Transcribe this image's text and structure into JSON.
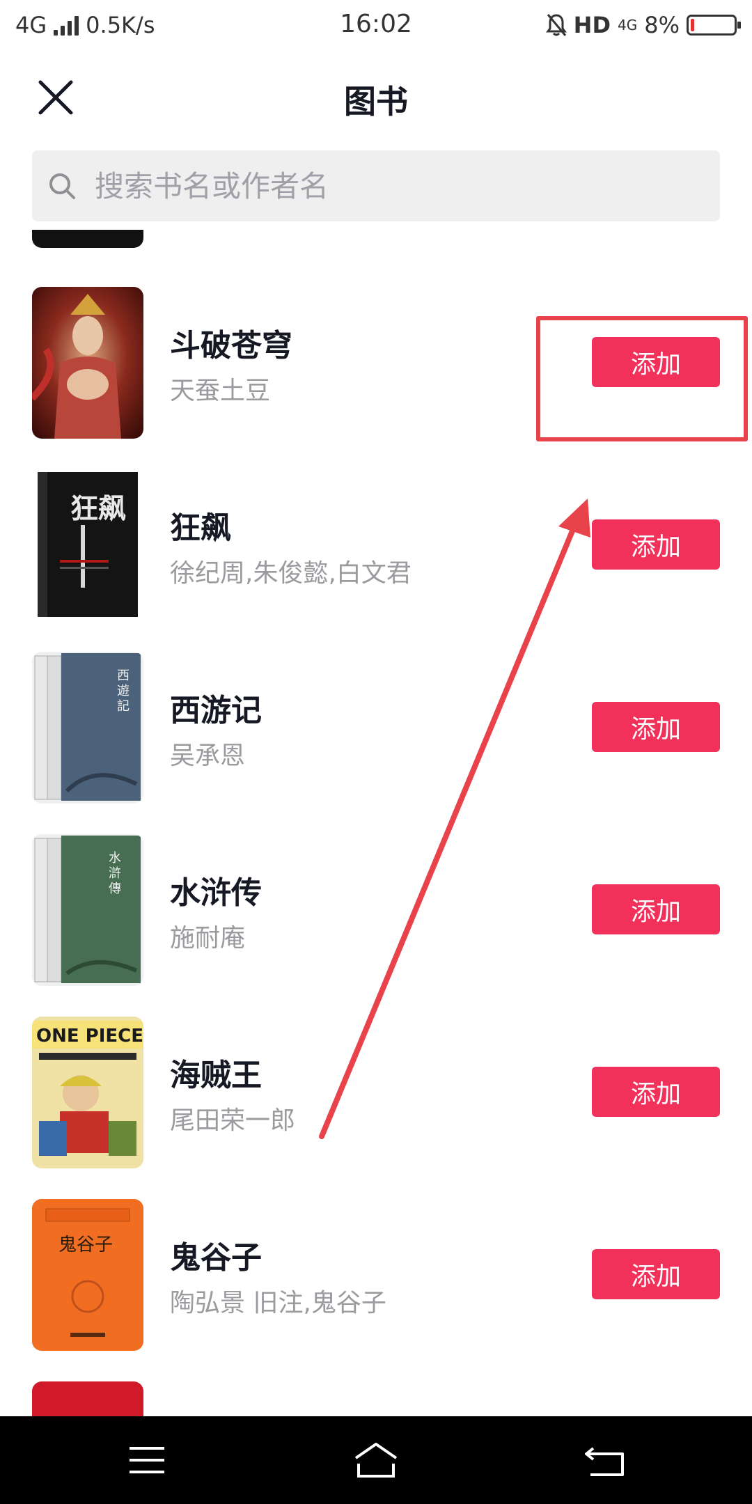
{
  "status_bar": {
    "network": "4G",
    "speed": "0.5K/s",
    "time": "16:02",
    "hd": "HD",
    "network2": "4G",
    "battery": "8%",
    "battery_level": 0.08
  },
  "header": {
    "title": "图书"
  },
  "search": {
    "placeholder": "搜索书名或作者名"
  },
  "books": [
    {
      "title": "斗破苍穹",
      "author": "天蚕土豆",
      "button": "添加",
      "cover": "fantasy-illustration"
    },
    {
      "title": "狂飙",
      "author": "徐纪周,朱俊懿,白文君",
      "button": "添加",
      "cover": "black-book"
    },
    {
      "title": "西游记",
      "author": "吴承恩",
      "button": "添加",
      "cover": "blue-classic"
    },
    {
      "title": "水浒传",
      "author": "施耐庵",
      "button": "添加",
      "cover": "green-classic"
    },
    {
      "title": "海贼王",
      "author": "尾田荣一郎",
      "button": "添加",
      "cover": "manga"
    },
    {
      "title": "鬼谷子",
      "author": "陶弘景 旧注,鬼谷子",
      "button": "添加",
      "cover": "orange-book"
    }
  ],
  "colors": {
    "accent": "#f2315b",
    "annotation": "#e8424a",
    "title_text": "#161823",
    "secondary_text": "#9a9a9f"
  }
}
